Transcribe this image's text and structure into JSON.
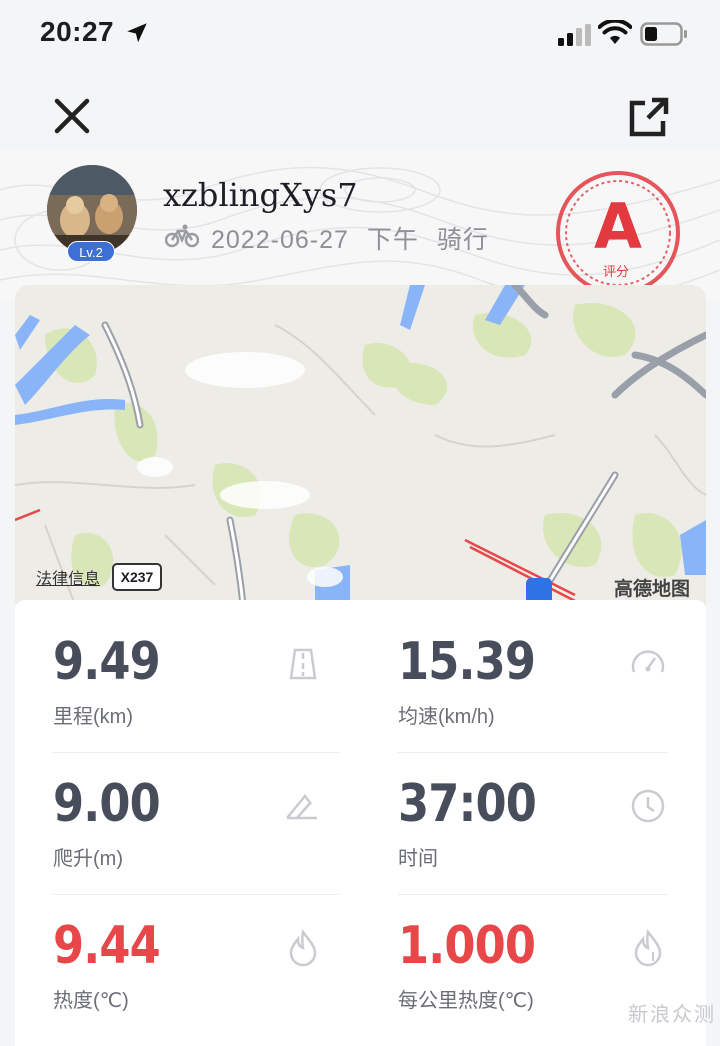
{
  "status_bar": {
    "time": "20:27"
  },
  "profile": {
    "username": "xzblingXys7",
    "level": "Lv.2",
    "date": "2022-06-27",
    "period": "下午",
    "activity": "骑行",
    "grade": "A",
    "grade_label": "评分"
  },
  "map": {
    "legal_link": "法律信息",
    "road_badge": "X237",
    "provider": "高德地图"
  },
  "stats": [
    {
      "value": "9.49",
      "label": "里程(km)",
      "icon": "road-icon",
      "color": "#484d5c"
    },
    {
      "value": "15.39",
      "label": "均速(km/h)",
      "icon": "speedometer-icon",
      "color": "#484d5c"
    },
    {
      "value": "9.00",
      "label": "爬升(m)",
      "icon": "climb-icon",
      "color": "#484d5c"
    },
    {
      "value": "37:00",
      "label": "时间",
      "icon": "clock-icon",
      "color": "#484d5c"
    },
    {
      "value": "9.44",
      "label": "热度(℃)",
      "icon": "flame-icon",
      "color": "#e8474a"
    },
    {
      "value": "1.000",
      "label": "每公里热度(℃)",
      "icon": "flame-per-km-icon",
      "color": "#e8474a"
    }
  ],
  "watermark": "新浪众测"
}
